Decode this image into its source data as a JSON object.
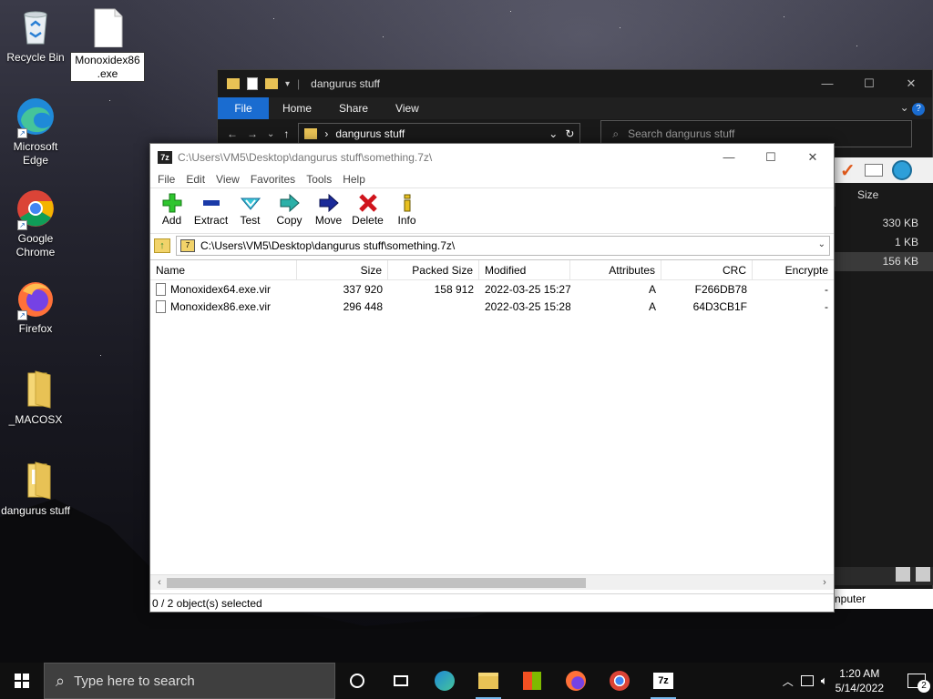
{
  "desktop": {
    "icons": [
      {
        "label": "Recycle Bin",
        "icon": "recycle-bin-icon"
      },
      {
        "label": "Microsoft Edge",
        "icon": "edge-icon"
      },
      {
        "label": "Google Chrome",
        "icon": "chrome-icon"
      },
      {
        "label": "Firefox",
        "icon": "firefox-icon"
      },
      {
        "label": "_MACOSX",
        "icon": "folder-icon"
      },
      {
        "label": "dangurus stuff",
        "icon": "folder-icon"
      }
    ],
    "renaming_file": {
      "icon": "file-icon",
      "name_line1": "Monoxidex86",
      "name_line2": ".exe"
    }
  },
  "explorer": {
    "title": "dangurus stuff",
    "ribbon_tabs": [
      "File",
      "Home",
      "Share",
      "View"
    ],
    "address": "dangurus stuff",
    "search_placeholder": "Search dangurus stuff",
    "size_header": "Size",
    "sizes": [
      "330 KB",
      "1 KB",
      "156 KB"
    ],
    "status_text": "nputer"
  },
  "sevenzip": {
    "title": "C:\\Users\\VM5\\Desktop\\dangurus stuff\\something.7z\\",
    "app_icon_text": "7z",
    "menu": [
      "File",
      "Edit",
      "View",
      "Favorites",
      "Tools",
      "Help"
    ],
    "toolbar": [
      {
        "label": "Add",
        "icon": "add-icon"
      },
      {
        "label": "Extract",
        "icon": "extract-icon"
      },
      {
        "label": "Test",
        "icon": "test-icon"
      },
      {
        "label": "Copy",
        "icon": "copy-icon"
      },
      {
        "label": "Move",
        "icon": "move-icon"
      },
      {
        "label": "Delete",
        "icon": "delete-icon"
      },
      {
        "label": "Info",
        "icon": "info-icon"
      }
    ],
    "address": "C:\\Users\\VM5\\Desktop\\dangurus stuff\\something.7z\\",
    "columns": [
      "Name",
      "Size",
      "Packed Size",
      "Modified",
      "Attributes",
      "CRC",
      "Encrypte"
    ],
    "rows": [
      {
        "name": "Monoxidex64.exe.vir",
        "size": "337 920",
        "packed": "158 912",
        "modified": "2022-03-25 15:27",
        "attributes": "A",
        "crc": "F266DB78",
        "encrypted": "-"
      },
      {
        "name": "Monoxidex86.exe.vir",
        "size": "296 448",
        "packed": "",
        "modified": "2022-03-25 15:28",
        "attributes": "A",
        "crc": "64D3CB1F",
        "encrypted": "-"
      }
    ],
    "status": "0 / 2 object(s) selected"
  },
  "taskbar": {
    "search_placeholder": "Type here to search",
    "pinned": [
      "task-view-icon",
      "edge-icon",
      "file-explorer-icon",
      "store-icon",
      "firefox-icon",
      "chrome-icon",
      "7zip-icon"
    ],
    "time": "1:20 AM",
    "date": "5/14/2022",
    "notification_count": "2"
  }
}
